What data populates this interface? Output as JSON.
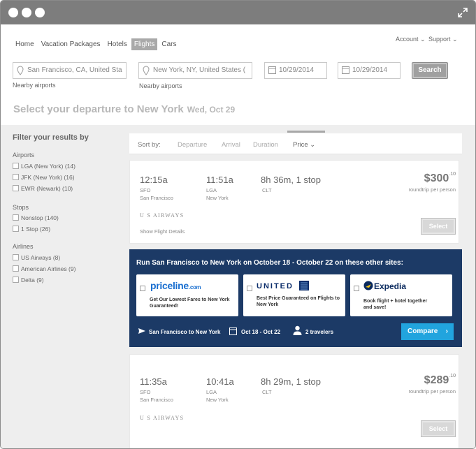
{
  "nav": {
    "items": [
      {
        "label": "Home",
        "active": false
      },
      {
        "label": "Vacation Packages",
        "active": false
      },
      {
        "label": "Hotels",
        "active": false
      },
      {
        "label": "Flights",
        "active": true
      },
      {
        "label": "Cars",
        "active": false
      }
    ],
    "account": "Account",
    "support": "Support"
  },
  "search": {
    "from": "San Francisco, CA, United Sta",
    "to": "New York, NY, United States (",
    "depart": "10/29/2014",
    "return": "10/29/2014",
    "button": "Search",
    "nearby": "Nearby airports"
  },
  "heading": {
    "title": "Select your departure to New York",
    "date": "Wed, Oct 29"
  },
  "filters": {
    "title": "Filter your results by",
    "airports_label": "Airports",
    "airports": [
      "LGA (New York) (14)",
      "JFK (New York) (16)",
      "EWR (Newark) (10)"
    ],
    "stops_label": "Stops",
    "stops": [
      "Nonstop (140)",
      "1 Stop (26)"
    ],
    "airlines_label": "Airlines",
    "airlines": [
      "US Airways (8)",
      "American Airlines (9)",
      "Delta (9)"
    ]
  },
  "sort": {
    "label": "Sort by:",
    "options": [
      "Departure",
      "Arrival",
      "Duration",
      "Price"
    ],
    "active": "Price"
  },
  "flights": [
    {
      "depart_time": "12:15a",
      "depart_code": "SFO",
      "depart_city": "San Francisco",
      "arrive_time": "11:51a",
      "arrive_code": "LGA",
      "arrive_city": "New York",
      "duration": "8h  36m, 1 stop",
      "via": "CLT",
      "price": "$300",
      "cents": ".10",
      "price_note": "roundtrip per person",
      "airline": "U S AIRWAYS",
      "details": "Show Flight Details",
      "select": "Select"
    },
    {
      "depart_time": "11:35a",
      "depart_code": "SFO",
      "depart_city": "San Francisco",
      "arrive_time": "10:41a",
      "arrive_code": "LGA",
      "arrive_city": "New York",
      "duration": "8h  29m, 1 stop",
      "via": "CLT",
      "price": "$289",
      "cents": ".10",
      "price_note": "roundtrip per person",
      "airline": "U S AIRWAYS",
      "select": "Select"
    }
  ],
  "promo": {
    "title": "Run San Francisco to New York on October 18 - October 22 on these other sites:",
    "sites": [
      {
        "name": "priceline.com",
        "name_main": "priceline",
        "name_suffix": ".com",
        "desc_1": "Get Our Lowest Fares to New York",
        "desc_2": "Guaranteed!"
      },
      {
        "name": "UNITED",
        "desc_1": "Best Price Guaranteed on Flights to",
        "desc_2": "New York"
      },
      {
        "name": "Expedia",
        "desc_1": "Book flight + hotel together",
        "desc_2": "and save!"
      }
    ],
    "route": "San Francisco to New York",
    "dates": "Oct 18 - Oct 22",
    "travelers": "2 travelers",
    "compare": "Compare",
    "colors": {
      "banner": "#1c3a66",
      "button": "#21a4de"
    }
  }
}
